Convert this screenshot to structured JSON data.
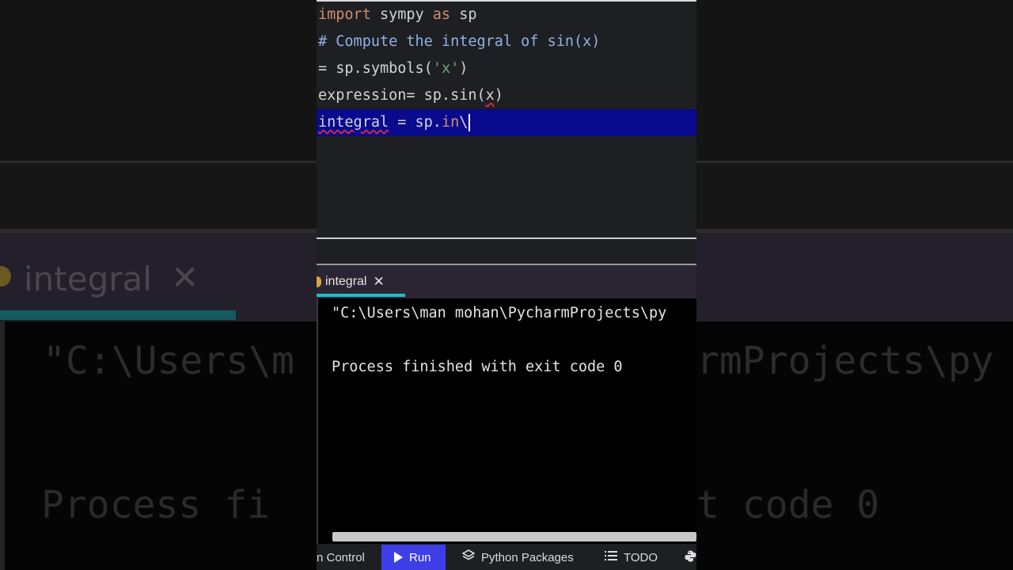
{
  "editor": {
    "lines": [
      {
        "parts": [
          {
            "t": "import",
            "c": "kw"
          },
          {
            "t": " sympy ",
            "c": ""
          },
          {
            "t": "as",
            "c": "kw"
          },
          {
            "t": " sp",
            "c": ""
          }
        ]
      },
      {
        "parts": [
          {
            "t": "# Compute the integral of sin(x)",
            "c": "cm"
          }
        ]
      },
      {
        "parts": [
          {
            "t": "= ",
            "c": ""
          },
          {
            "t": "sp.symbols(",
            "c": ""
          },
          {
            "t": "'x'",
            "c": "str"
          },
          {
            "t": ")",
            "c": ""
          }
        ]
      },
      {
        "parts": [
          {
            "t": "expression= sp.sin(",
            "c": ""
          },
          {
            "t": "x",
            "c": "err"
          },
          {
            "t": ")",
            "c": ""
          }
        ]
      },
      {
        "parts": [
          {
            "t": "integral",
            "c": "err"
          },
          {
            "t": " = sp.",
            "c": ""
          },
          {
            "t": "in",
            "c": "fn"
          },
          {
            "t": "\\",
            "c": ""
          }
        ]
      }
    ]
  },
  "run_tab": {
    "label": "integral",
    "close": "✕"
  },
  "console": {
    "line1": "\"C:\\Users\\man mohan\\PycharmProjects\\py",
    "line2": "Process finished with exit code 0"
  },
  "toolbar": {
    "version_control": "n Control",
    "run": "Run",
    "python_packages": "Python Packages",
    "todo": "TODO"
  },
  "background": {
    "tab_label": "integral",
    "tab_close": "✕",
    "console_left_1": "\"C:\\Users\\m",
    "console_left_2": "Process fi",
    "console_right_1": "rmProjects\\py",
    "console_right_2": "t code 0"
  }
}
